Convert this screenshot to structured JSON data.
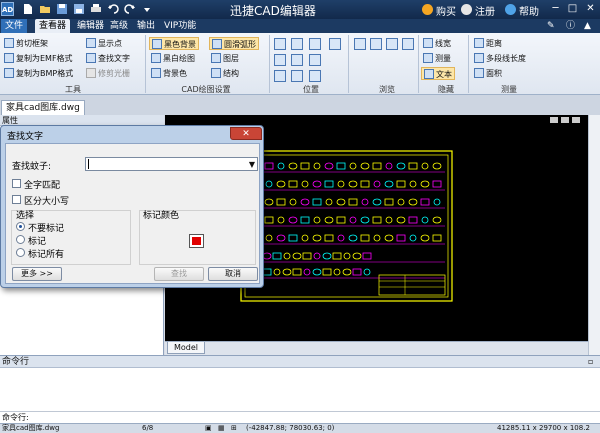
{
  "app": {
    "logo_text": "AD",
    "title": "迅捷CAD编辑器",
    "purchase": "购买",
    "register": "注册",
    "help": "帮助"
  },
  "menu": {
    "file": "文件",
    "tabs": [
      "查看器",
      "编辑器",
      "高级",
      "输出",
      "VIP功能"
    ]
  },
  "ribbon": {
    "tools": {
      "label": "工具",
      "items": [
        "剪切框架",
        "复制为EMF格式",
        "复制为BMP格式",
        "显示点",
        "查找文字",
        "修剪光栅"
      ]
    },
    "cad_settings": {
      "label": "CAD绘图设置",
      "items": [
        "黑色背景",
        "圆滑弧形",
        "黑白绘图",
        "图层",
        "背景色",
        "结构"
      ]
    },
    "position": {
      "label": "位置"
    },
    "browse": {
      "label": "浏览"
    },
    "hide": {
      "label": "隐藏",
      "items": [
        "线宽",
        "测量",
        "文本"
      ]
    },
    "measure": {
      "label": "测量",
      "items": [
        "距离",
        "多段线长度",
        "面积"
      ]
    }
  },
  "document_tab": "家具cad图库.dwg",
  "properties_panel_title": "属性",
  "model_tab": "Model",
  "command_panel_title": "命令行",
  "command_prompt_label": "命令行:",
  "status": {
    "file": "家具cad图库.dwg",
    "page": "6/8",
    "coordinates": "(-42847.88; 78030.63; 0)",
    "size": "41285.11 x 29700 x 108.2"
  },
  "find_dialog": {
    "title": "查找文字",
    "close": "✕",
    "find_label": "查找蚊子:",
    "find_value": "",
    "whole_word": "全字匹配",
    "match_case": "区分大小写",
    "selection_title": "选择",
    "radio_options": [
      "不要标记",
      "标记",
      "标记所有"
    ],
    "selected_radio": 0,
    "mark_color_title": "标记颜色",
    "mark_color": "#e00000",
    "more_button": "更多 >>",
    "find_button": "查找",
    "cancel_button": "取消"
  },
  "colors": {
    "canvas": "#000000",
    "frame": "#ffff00",
    "magenta": "#ff00ff",
    "cyan": "#00ffff"
  }
}
